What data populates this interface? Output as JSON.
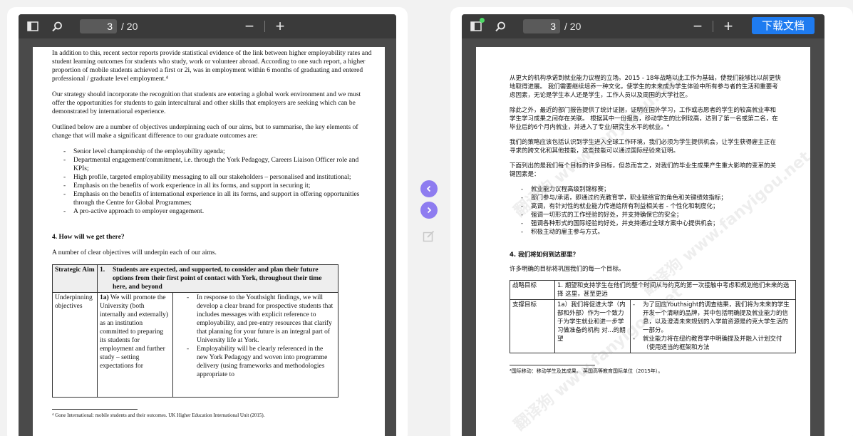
{
  "left_viewer": {
    "page_current": "3",
    "page_total": "/ 20",
    "zoom_out": "−",
    "zoom_in": "+"
  },
  "right_viewer": {
    "page_current": "3",
    "page_total": "/ 20",
    "zoom_out": "−",
    "zoom_in": "+",
    "download_label": "下载文档"
  },
  "doc_en": {
    "p1": "In addition to this, recent sector reports provide statistical evidence of the link between higher employability rates and student learning outcomes for students who study, work or volunteer abroad.  According to one such report, a higher proportion of mobile students achieved a first or 2i, was in employment within 6 months of graduating and entered professional / graduate level employment.⁴",
    "p2": "Our strategy should incorporate the recognition that students are entering a global work environment and we must offer the opportunities for students to gain intercultural and other skills that employers are seeking which can be demonstrated by international experience.",
    "p3": "Outlined below are a number of objectives underpinning each of our aims, but to summarise, the key elements of change that will make a significant difference to our graduate outcomes are:",
    "bullets": [
      "Senior level championship of the employability agenda;",
      "Departmental engagement/commitment, i.e. through the York Pedagogy, Careers Liaison Officer role and KPIs;",
      "High profile, targeted employability messaging to all our stakeholders – personalised and institutional;",
      "Emphasis on the benefits of work experience in all its forms, and support in securing it;",
      "Emphasis on the benefits of international experience in all its forms, and support in offering opportunities through the Centre for Global Programmes;",
      "A pro-active approach to employer engagement."
    ],
    "heading": "4. How will we get there?",
    "intro": "A number of clear objectives will underpin each of our aims.",
    "table": {
      "aim_label": "Strategic Aim",
      "aim_number": "1.",
      "aim_text": "Students are expected, and supported, to consider and plan their future options from their first point of contact with York, throughout their time here, and beyond",
      "obj_label": "Underpinning objectives",
      "obj_number": "1a)",
      "obj_text": "We will promote the University (both internally and externally) as an institution committed to preparing its students for employment and further study – setting expectations for",
      "actions": [
        "In response to the Youthsight findings, we will develop a clear brand for prospective students that includes messages with explicit reference to employability, and pre-entry resources that clarify that planning for your future is an integral part of University life at York.",
        "Employability will be clearly referenced in the new York Pedagogy and woven into programme delivery (using frameworks and methodologies appropriate to"
      ]
    },
    "footnote": "⁴ Gone International: mobile students and their outcomes. UK Higher Education International Unit (2015)."
  },
  "doc_zh": {
    "p1": "从更大的机构承诺到就业能力议程的立场。2015 - 18年战略以此工作为基础，使我们能够比以前更快地取得进展。 我们需要继续培养一种文化，使学生的未来成为学生体验中所有参与者的生活和重要考虑因素，无论是学生本人还是学生，工作人员以及周围的大学社区。",
    "p2": "除此之外，最近的部门报告提供了统计证据，证明在国外学习，工作或志愿者的学生的较高就业率和学生学习成果之间存在关联。 根据其中一份报告，移动学生的比例较高，达到了第一名或第二名，在毕业后的6个月内就业，并进入了专业/研究生水平的就业。⁴",
    "p3": "我们的策略应该包括认识到学生进入全球工作环境，我们必须为学生提供机会，让学生获得雇主正在寻求的跨文化和其他技能，这些技能可以通过国际经验来证明。",
    "p4": "下面列出的是我们每个目标的许多目标，但总而言之，对我们的毕业生成果产生重大影响的变革的关键因素是：",
    "bullets": [
      "就业能力议程高级别锦标赛；",
      "部门参与/承诺，即通过约克教育学，职业联络官的角色和关键绩效指标；",
      "高调，有针对性的就业能力传递给所有利益相关者 - 个性化和制度化；",
      "强调一切形式的工作经验的好处，并支持确保它的安全；",
      "强调各种形式的国际经验的好处，并支持通过全球方案中心提供机会；",
      "积极主动的雇主参与方式。"
    ],
    "heading": "4. 我们将如何到达那里？",
    "intro": "许多明确的目标将巩固我们的每一个目标。",
    "table": {
      "aim_label": "战略目标",
      "aim_text": "1. 期望和支持学生在他们的整个时间从与约克的第一次接触中考虑和规划他们未来的选择 这里，甚至更远",
      "obj_label": "支撑目标",
      "obj_text": "1a）我们将促进大学（内部和外部）作为一个致力于为学生就业和进一步学习做准备的机构 对...的期望",
      "actions": [
        "为了回应Youthsight的调查结果，我们将为未来的学生开发一个清晰的品牌，其中包括明确提及就业能力的信息，以及澄清未来规划的入学前资源是约克大学生活的一部分。",
        "就业能力将在纽约教育学中明确提及并融入计划交付（使用适当的框架和方法"
      ]
    },
    "footnote": "⁴国际移动：移动学生及其成果。 英国高等教育国际单位（2015年）。",
    "watermark": "翻译狗 www.fanyigou.net"
  },
  "colors": {
    "accent": "#8e7cf0",
    "download": "#1e7bf0",
    "toolbar": "#3a3a3a"
  }
}
